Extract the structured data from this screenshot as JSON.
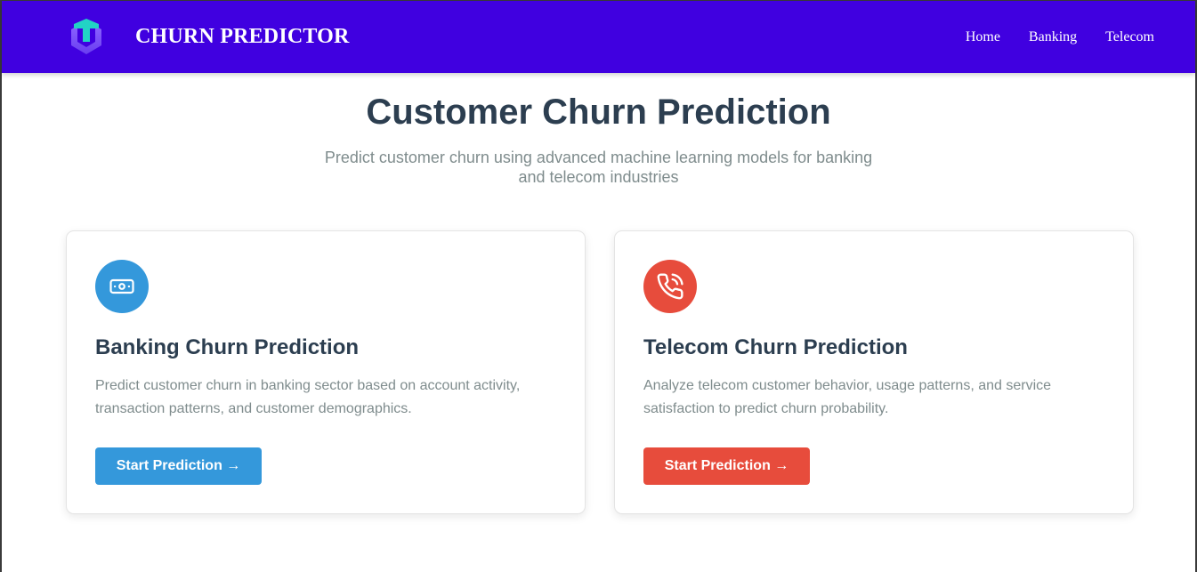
{
  "header": {
    "brand": "CHURN PREDICTOR",
    "logo_icon": "cube-logo-icon",
    "nav": [
      {
        "label": "Home"
      },
      {
        "label": "Banking"
      },
      {
        "label": "Telecom"
      }
    ],
    "background_color": "#4000e0"
  },
  "hero": {
    "title": "Customer Churn Prediction",
    "subtitle": "Predict customer churn using advanced machine learning models for banking and telecom industries"
  },
  "cards": [
    {
      "icon": "money-bill-icon",
      "icon_color": "#3498db",
      "title": "Banking Churn Prediction",
      "description": "Predict customer churn in banking sector based on account activity, transaction patterns, and customer demographics.",
      "button_label": "Start Prediction →",
      "button_color": "#3498db"
    },
    {
      "icon": "phone-call-icon",
      "icon_color": "#e74c3c",
      "title": "Telecom Churn Prediction",
      "description": "Analyze telecom customer behavior, usage patterns, and service satisfaction to predict churn probability.",
      "button_label": "Start Prediction →",
      "button_color": "#e74c3c"
    }
  ]
}
